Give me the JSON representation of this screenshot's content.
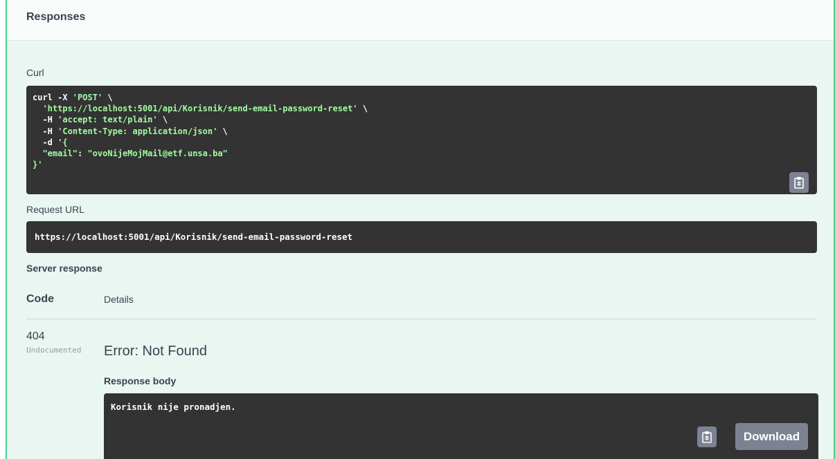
{
  "responses": {
    "title": "Responses"
  },
  "curl": {
    "label": "Curl",
    "cmd": "curl -X ",
    "method": "'POST'",
    "line2": "'https://localhost:5001/api/Korisnik/send-email-password-reset'",
    "line3_flag": "-H ",
    "line3_val": "'accept: text/plain'",
    "line4_flag": "-H ",
    "line4_val": "'Content-Type: application/json'",
    "line5_flag": "-d ",
    "line5_val": "'{",
    "line6_key": "\"email\"",
    "line6_sep": ": ",
    "line6_val": "\"ovoNijeMojMail@etf.unsa.ba\"",
    "line7": "}'",
    "backslash": " \\"
  },
  "request_url": {
    "label": "Request URL",
    "value": "https://localhost:5001/api/Korisnik/send-email-password-reset"
  },
  "server_response": {
    "label": "Server response",
    "col_code": "Code",
    "col_details": "Details",
    "code": "404",
    "code_note": "Undocumented",
    "error": "Error: Not Found",
    "body_label": "Response body",
    "body": "Korisnik nije pronadjen.",
    "download_label": "Download"
  },
  "icons": {
    "copy": "clipboard-icon"
  },
  "colors": {
    "accent": "#49cc90",
    "code_bg": "#333333",
    "string": "#a2fca2",
    "button": "#7d8293"
  }
}
